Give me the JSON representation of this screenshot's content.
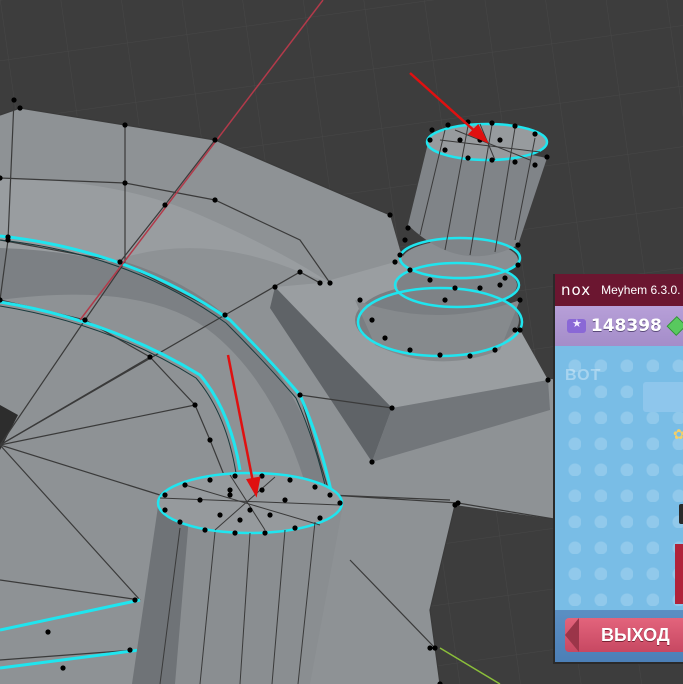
{
  "colors": {
    "grid": "#474747",
    "background": "#3d3d3d",
    "mesh_surface": "#8e9295",
    "mesh_dark": "#6c7074",
    "edge": "#3a3a3a",
    "selected_edge": "#1fe5ef",
    "vertex": "#000000",
    "axis_x": "#b23a4a",
    "axis_y": "#8bbf3a",
    "annotation_arrow": "#e01010",
    "nox_titlebar": "#6b1630"
  },
  "viewport": {
    "name": "3D mesh edit viewport",
    "annotations": [
      {
        "name": "arrow-top-cylinder",
        "target": "top cap of small cylinder"
      },
      {
        "name": "arrow-lower-cylinder",
        "target": "top cap of large cylinder"
      }
    ]
  },
  "nox_window": {
    "logo": "nox",
    "title": "Meyhem 6.3.0.",
    "coins": "148398",
    "faded_label": "ВОТ",
    "exit_label": "ВЫХОД",
    "icons": [
      "ticket-icon",
      "gem-icon",
      "flower-icon",
      "exit-arrow-icon"
    ]
  }
}
